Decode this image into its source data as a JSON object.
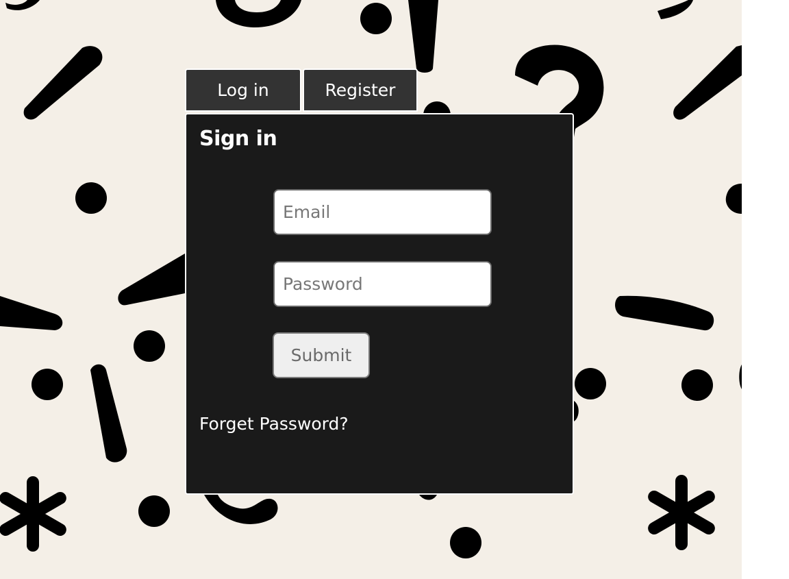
{
  "tabs": {
    "login_label": "Log in",
    "register_label": "Register"
  },
  "form": {
    "title": "Sign in",
    "email_placeholder": "Email",
    "password_placeholder": "Password",
    "submit_label": "Submit",
    "forgot_label": "Forget Password?"
  },
  "colors": {
    "background": "#f4efe7",
    "panel": "#1a1a1a",
    "tab": "#333333",
    "text": "#ffffff"
  }
}
